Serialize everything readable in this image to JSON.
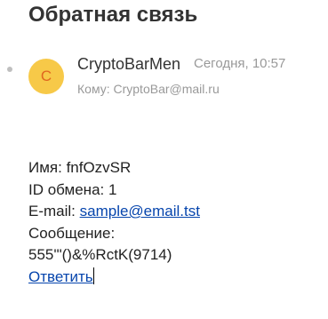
{
  "email": {
    "subject": "Обратная связь",
    "avatar_letter": "C",
    "sender_name": "CryptoBarMen",
    "date": "Сегодня, 10:57",
    "recipient": "Кому: CryptoBar@mail.ru",
    "body": {
      "name_label": "Имя: ",
      "name_value": "fnfOzvSR",
      "exchange_label": "ID обмена: ",
      "exchange_value": "1",
      "email_label": "E-mail: ",
      "email_value": "sample@email.tst",
      "message_label": "Сообщение:",
      "message_value": "555'\"()&%RctK(9714)",
      "reply_link": "Ответить"
    }
  },
  "colors": {
    "avatar_bg": "#f7c948",
    "avatar_text": "#e0671f",
    "link": "#0645ad",
    "muted": "#999999"
  }
}
